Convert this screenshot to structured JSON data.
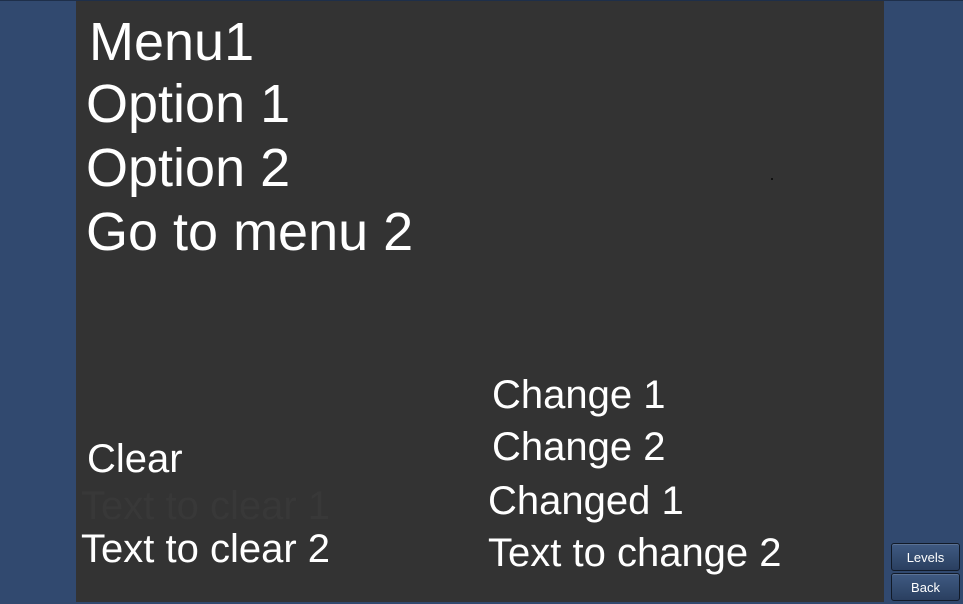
{
  "menu": {
    "title": "Menu1",
    "option1": "Option 1",
    "option2": "Option 2",
    "go_to_menu2": "Go to menu 2"
  },
  "clear_section": {
    "clear_label": "Clear",
    "text_to_clear_1": "Text to clear 1",
    "text_to_clear_2": "Text to clear 2"
  },
  "change_section": {
    "change1_label": "Change 1",
    "change2_label": "Change 2",
    "changed_text_1": "Changed 1",
    "text_to_change_2": "Text to change 2"
  },
  "side_buttons": {
    "levels_label": "Levels",
    "back_label": "Back"
  },
  "colors": {
    "background": "#31496f",
    "panel": "#333333",
    "text": "#ffffff",
    "faded_text": "#383838"
  }
}
